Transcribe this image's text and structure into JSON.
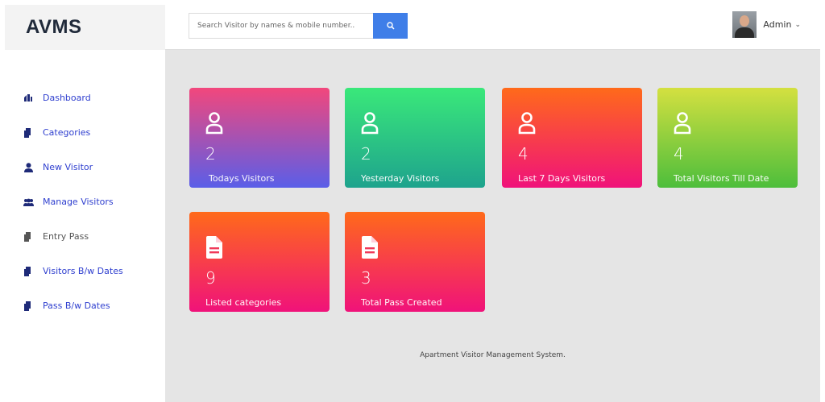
{
  "brand": {
    "name": "AVMS"
  },
  "search": {
    "placeholder": "Search Visitor by names & mobile number..",
    "value": ""
  },
  "user": {
    "name": "Admin",
    "caret": "⌄"
  },
  "sidebar": {
    "items": [
      {
        "label": "Dashboard",
        "icon": "dashboard-icon"
      },
      {
        "label": "Categories",
        "icon": "file-icon"
      },
      {
        "label": "New Visitor",
        "icon": "user-icon"
      },
      {
        "label": "Manage Visitors",
        "icon": "users-icon"
      },
      {
        "label": "Entry Pass",
        "icon": "file-icon"
      },
      {
        "label": "Visitors B/w Dates",
        "icon": "file-icon"
      },
      {
        "label": "Pass B/w Dates",
        "icon": "file-icon"
      }
    ]
  },
  "cards": [
    {
      "value": "2",
      "label": "Todays Visitors",
      "icon": "user-icon"
    },
    {
      "value": "2",
      "label": "Yesterday Visitors",
      "icon": "user-icon"
    },
    {
      "value": "4",
      "label": "Last 7 Days Visitors",
      "icon": "user-icon"
    },
    {
      "value": "4",
      "label": "Total Visitors Till Date",
      "icon": "user-icon"
    },
    {
      "value": "9",
      "label": "Listed categories",
      "icon": "document-icon"
    },
    {
      "value": "3",
      "label": "Total Pass Created",
      "icon": "document-icon"
    }
  ],
  "footer": {
    "text": "Apartment Visitor Management System."
  },
  "colors": {
    "accent": "#3f7ee8",
    "nav_text": "#2f3fcf",
    "brand_text": "#202a3a"
  }
}
